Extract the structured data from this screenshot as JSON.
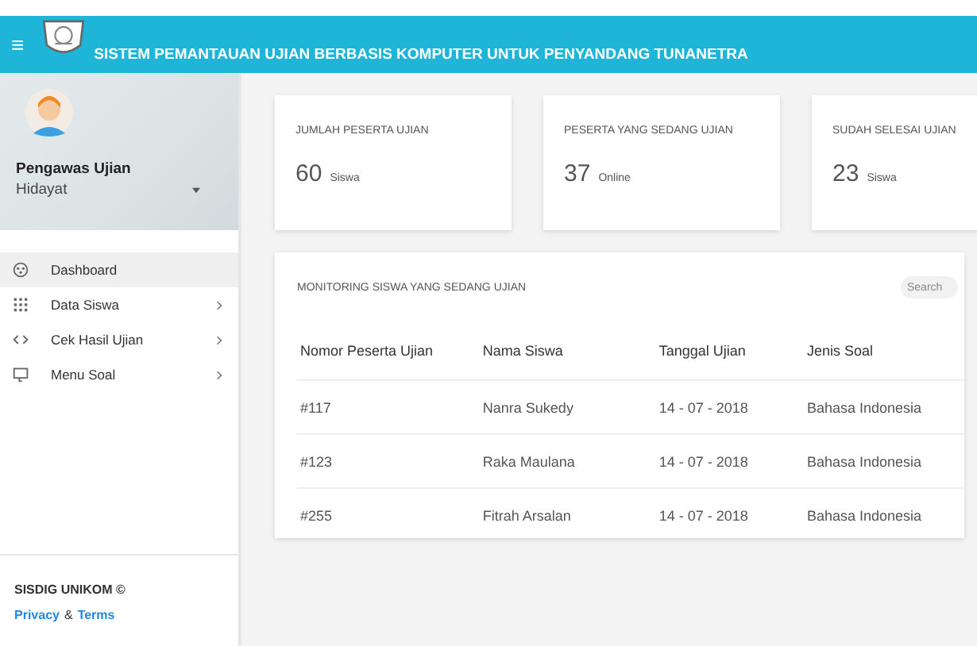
{
  "header": {
    "menu_glyph": "≡",
    "title": "SISTEM PEMANTAUAN UJIAN BERBASIS KOMPUTER UNTUK PENYANDANG TUNANETRA"
  },
  "profile": {
    "role": "Pengawas Ujian",
    "name": "Hidayat"
  },
  "sidebar": {
    "items": [
      {
        "label": "Dashboard",
        "selected": true,
        "has_submenu": false
      },
      {
        "label": "Data Siswa",
        "selected": false,
        "has_submenu": true
      },
      {
        "label": "Cek Hasil Ujian",
        "selected": false,
        "has_submenu": true
      },
      {
        "label": "Menu Soal",
        "selected": false,
        "has_submenu": true
      }
    ],
    "footer": {
      "copyright": "SISDIG UNIKOM ©",
      "privacy": "Privacy",
      "amp": "&",
      "terms": "Terms"
    }
  },
  "stats": [
    {
      "title": "JUMLAH PESERTA UJIAN",
      "value": "60",
      "unit": "Siswa"
    },
    {
      "title": "PESERTA YANG SEDANG UJIAN",
      "value": "37",
      "unit": "Online"
    },
    {
      "title": "SUDAH SELESAI UJIAN",
      "value": "23",
      "unit": "Siswa"
    }
  ],
  "monitoring": {
    "title": "MONITORING SISWA YANG SEDANG UJIAN",
    "search": {
      "placeholder": "Search"
    },
    "columns": [
      "Nomor Peserta Ujian",
      "Nama Siswa",
      "Tanggal Ujian",
      "Jenis Soal"
    ],
    "rows": [
      [
        "#117",
        "Nanra Sukedy",
        "14 - 07 - 2018",
        "Bahasa Indonesia"
      ],
      [
        "#123",
        "Raka Maulana",
        "14 - 07 - 2018",
        "Bahasa Indonesia"
      ],
      [
        "#255",
        "Fitrah Arsalan",
        "14 - 07 - 2018",
        "Bahasa Indonesia"
      ]
    ]
  }
}
